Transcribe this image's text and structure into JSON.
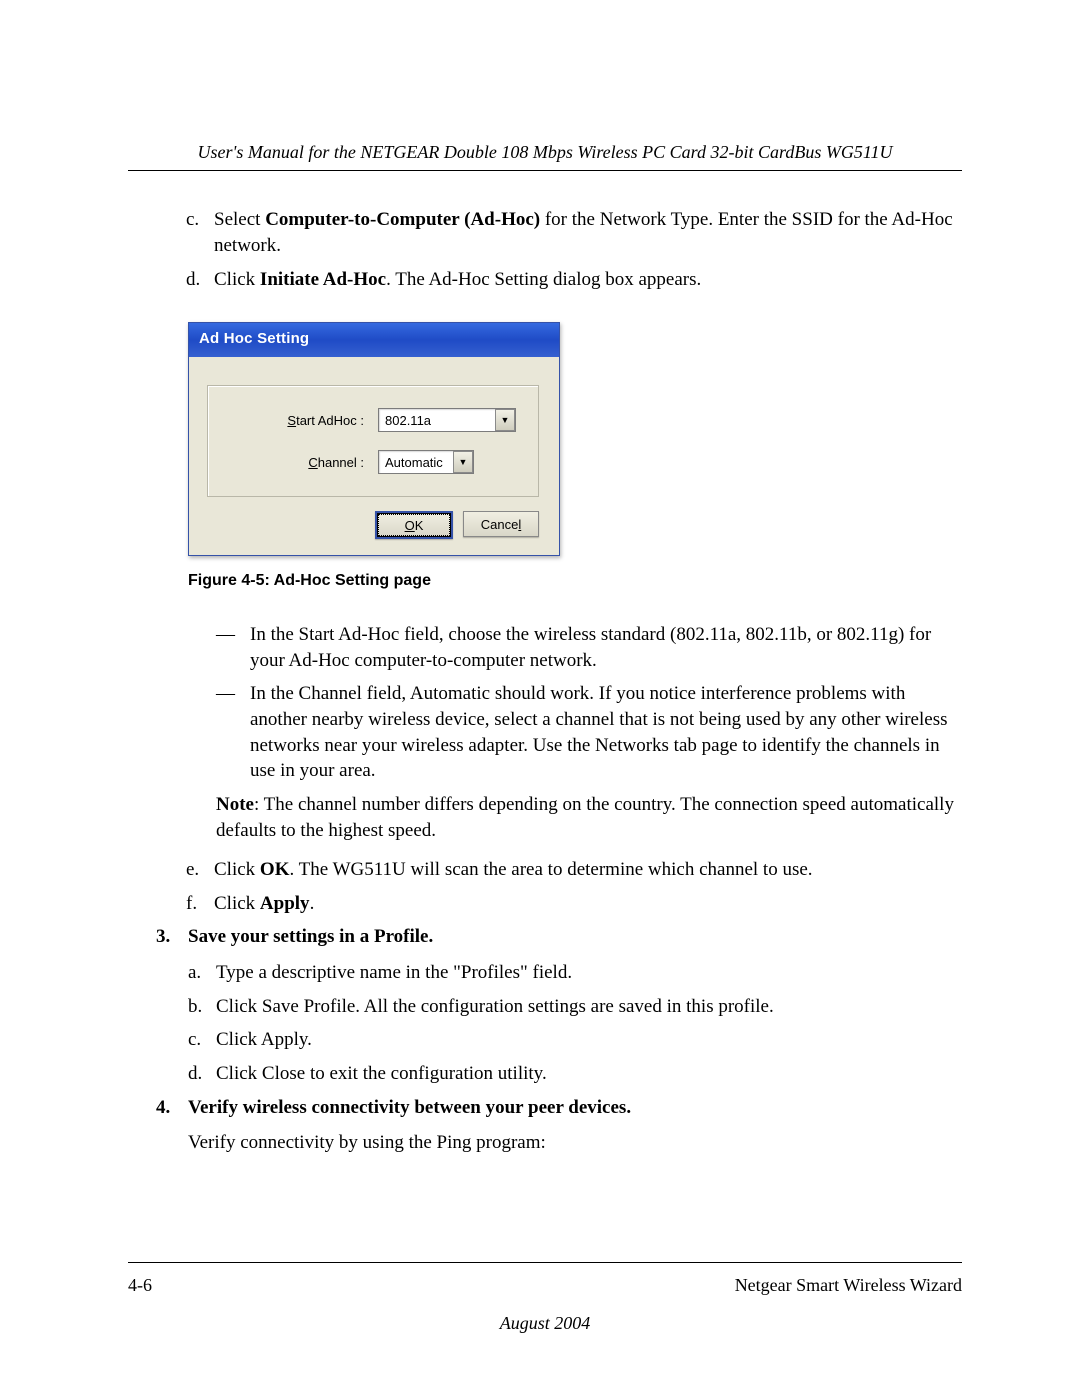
{
  "header": "User's Manual for the NETGEAR Double 108 Mbps Wireless PC Card 32-bit CardBus WG511U",
  "section_c": {
    "marker": "c.",
    "pre": "Select ",
    "bold": "Computer-to-Computer (Ad-Hoc)",
    "post": " for the Network Type. Enter the SSID for the Ad-Hoc network."
  },
  "section_d": {
    "marker": "d.",
    "pre": "Click ",
    "bold": "Initiate Ad-Hoc",
    "post": ". The Ad-Hoc Setting dialog box appears."
  },
  "dialog": {
    "title": "Ad Hoc Setting",
    "start_adhoc_label": {
      "u": "S",
      "rest": "tart AdHoc :"
    },
    "start_adhoc_value": "802.11a",
    "channel_label": {
      "u": "C",
      "rest": "hannel :"
    },
    "channel_value": "Automatic",
    "ok_label": {
      "u": "O",
      "rest": "K"
    },
    "cancel_label": {
      "pre": "Cance",
      "u": "l"
    }
  },
  "figure_caption": "Figure 4-5:  Ad-Hoc Setting page",
  "bullets": [
    "In the Start Ad-Hoc field, choose the wireless standard (802.11a, 802.11b, or 802.11g) for your Ad-Hoc computer-to-computer network.",
    "In the Channel field, Automatic should work. If you notice interference problems with another nearby wireless device, select a channel that is not being used by any other wireless networks near your wireless adapter. Use the Networks tab page to identify the channels in use in your area."
  ],
  "note": {
    "bold": "Note",
    "text": ": The channel number differs depending on the country. The connection speed automatically defaults to the highest speed."
  },
  "section_e": {
    "marker": "e.",
    "pre": "Click ",
    "bold": "OK",
    "post": ". The WG511U will scan the area to determine which channel to use."
  },
  "section_f": {
    "marker": "f.",
    "pre": "Click ",
    "bold": "Apply",
    "post": "."
  },
  "step3": {
    "marker": "3.",
    "title": "Save your settings in a Profile.",
    "items": [
      {
        "marker": "a.",
        "text": "Type a descriptive name in the \"Profiles\" field."
      },
      {
        "marker": "b.",
        "text": "Click Save Profile. All the configuration settings are saved in this profile."
      },
      {
        "marker": "c.",
        "text": "Click Apply."
      },
      {
        "marker": "d.",
        "text": "Click Close to exit the configuration utility."
      }
    ]
  },
  "step4": {
    "marker": "4.",
    "title": "Verify wireless connectivity between your peer devices.",
    "text": "Verify connectivity by using the Ping program:"
  },
  "footer": {
    "left": "4-6",
    "right": "Netgear Smart Wireless Wizard",
    "date": "August 2004"
  }
}
